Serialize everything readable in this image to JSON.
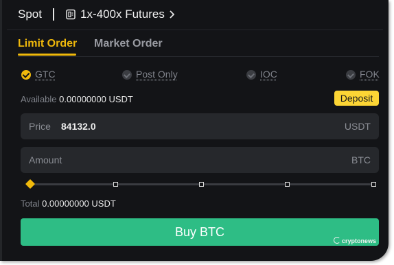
{
  "topbar": {
    "spot_label": "Spot",
    "futures_label": "1x-400x Futures",
    "futures_icon": "document-icon",
    "chevron_icon": "chevron-right-icon"
  },
  "tabs": [
    {
      "label": "Limit Order",
      "active": true
    },
    {
      "label": "Market Order",
      "active": false
    }
  ],
  "time_in_force": [
    {
      "label": "GTC",
      "checked": true
    },
    {
      "label": "Post Only",
      "checked": false
    },
    {
      "label": "IOC",
      "checked": false
    },
    {
      "label": "FOK",
      "checked": false
    }
  ],
  "available": {
    "label": "Available",
    "value": "0.00000000 USDT"
  },
  "deposit_label": "Deposit",
  "price": {
    "label": "Price",
    "value": "84132.0",
    "unit": "USDT"
  },
  "amount": {
    "label": "Amount",
    "placeholder": "Amount",
    "unit": "BTC"
  },
  "slider": {
    "percent": 0
  },
  "total": {
    "label": "Total",
    "value": "0.00000000 USDT"
  },
  "buy_label": "Buy BTC",
  "watermark": "cryptonews",
  "colors": {
    "accent": "#f0b90b",
    "buy": "#2ebd85",
    "deposit": "#fcd535",
    "background": "#131417"
  }
}
